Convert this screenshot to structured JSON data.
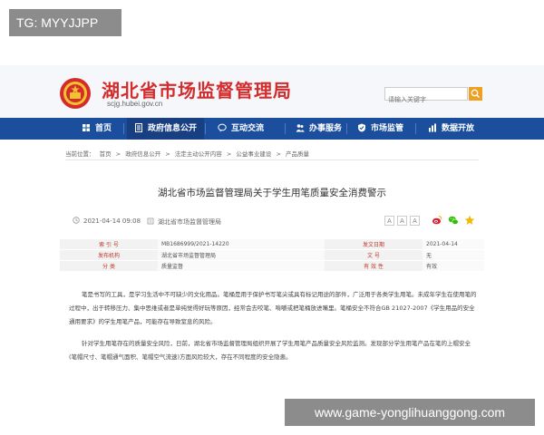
{
  "watermark": {
    "tag": "TG: MYYJJPP",
    "url": "www.game-yonglihuanggong.com"
  },
  "header": {
    "site_title": "湖北省市场监督管理局",
    "site_domain": "scjg.hubei.gov.cn",
    "search_placeholder": "请输入关键字",
    "emblem_icon": "national-emblem-icon",
    "title_color": "#d42c2c"
  },
  "nav": {
    "color": "#1c4e9e",
    "items": [
      {
        "label": "首页",
        "icon": "home-icon"
      },
      {
        "label": "政府信息公开",
        "icon": "document-list-icon"
      },
      {
        "label": "互动交流",
        "icon": "chat-bubble-icon"
      },
      {
        "label": "办事服务",
        "icon": "people-icon"
      },
      {
        "label": "市场监管",
        "icon": "shield-icon"
      },
      {
        "label": "数据开放",
        "icon": "chart-icon"
      }
    ]
  },
  "breadcrumb": {
    "prefix": "当前位置：",
    "items": [
      "首页",
      "政府信息公开",
      "法定主动公开内容",
      "公益事业建设",
      "产品质量"
    ],
    "separator": ">"
  },
  "article": {
    "title": "湖北省市场监督管理局关于学生用笔质量安全消费警示",
    "date": "2021-04-14 09:08",
    "source": "湖北省市场监督管理局",
    "font_sizes": [
      "A",
      "A",
      "A"
    ],
    "share_icons": [
      "weibo-icon",
      "wechat-icon",
      "favorite-star-icon"
    ]
  },
  "info_table": {
    "rows": [
      {
        "label1": "索 引 号",
        "value1": "MB1686999/2021-14220",
        "label2": "发文日期",
        "value2": "2021-04-14"
      },
      {
        "label1": "发布机构",
        "value1": "湖北省市场监督管理局",
        "label2": "文 号",
        "value2": "无"
      },
      {
        "label1": "分 类",
        "value1": "质量监督",
        "label2": "有 效 性",
        "value2": "有效"
      }
    ]
  },
  "body": {
    "paragraphs": [
      "笔是书写的工具，是学习生活中不可缺少的文化用品。笔桶是用于保护书写笔尖或具有标记用途的部件，广泛用于各类学生用笔。未成年学生在使用笔的过程中，出于转移压力、集中思维或者是单纯觉得好玩等原因，经常会去咬笔、啃嚼或把笔桶放进嘴里。笔桶安全不符合GB 21027-2007《学生用品的安全通用要求》的学生用笔产品，可能存在导致窒息的风险。",
      "针对学生用笔存在的质量安全风险，日前，湖北省市场监督管理局组织开展了学生用笔产品质量安全风险监测。发现部分学生用笔产品在笔的上帽安全(笔帽尺寸、笔帽通气面积、笔帽空气流速)方面风险较大，存在不同程度的安全隐患。"
    ]
  }
}
